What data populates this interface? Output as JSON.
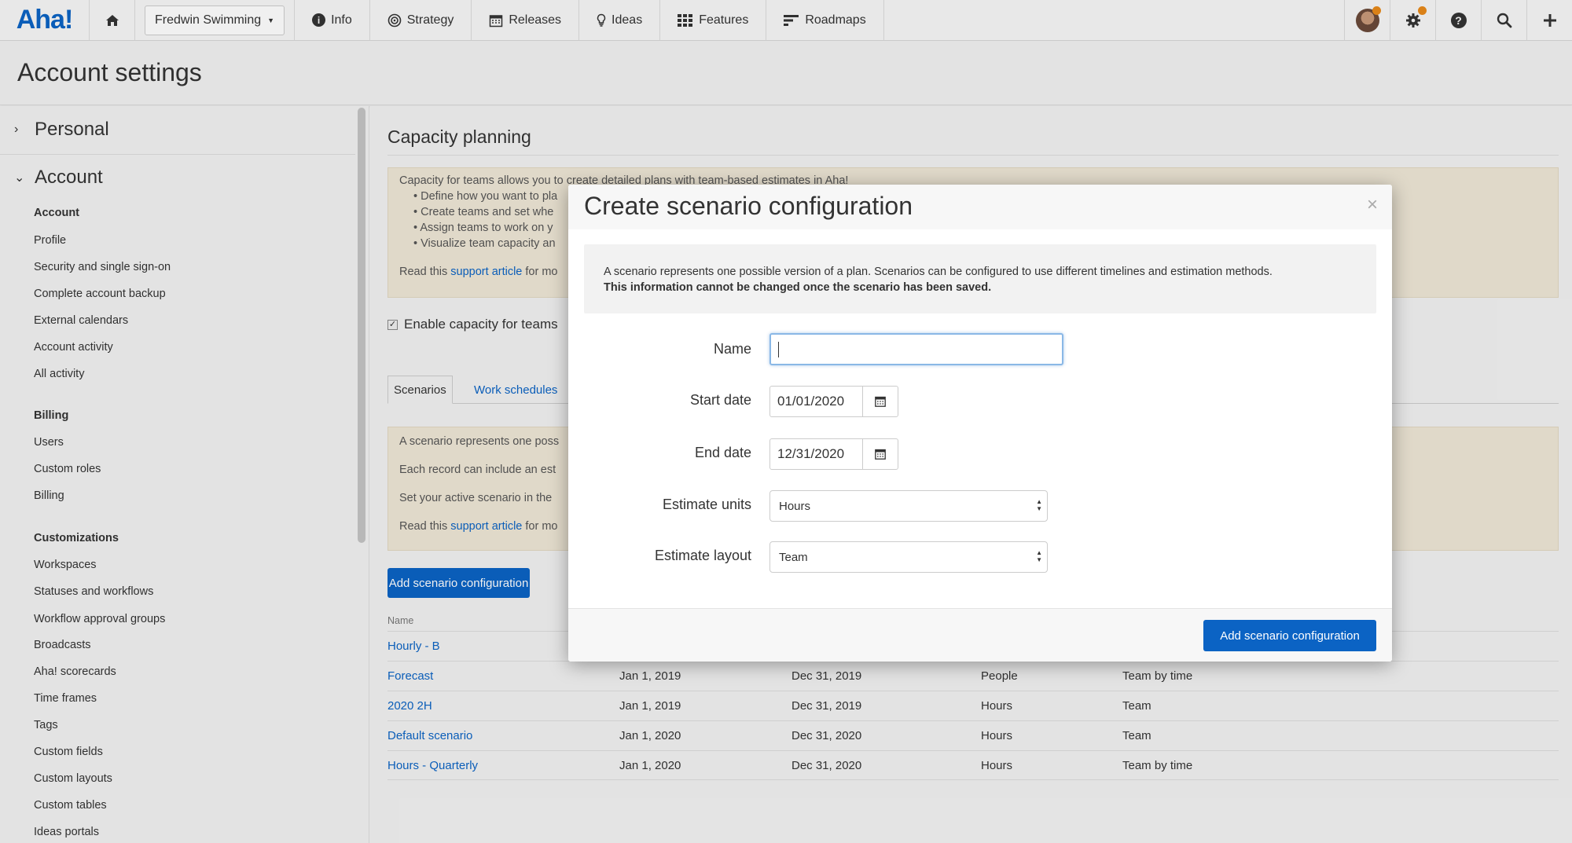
{
  "topnav": {
    "logo": "Aha!",
    "workspace": "Fredwin Swimming",
    "items": [
      {
        "label": "Info",
        "icon": "info-icon"
      },
      {
        "label": "Strategy",
        "icon": "target-icon"
      },
      {
        "label": "Releases",
        "icon": "calendar-icon"
      },
      {
        "label": "Ideas",
        "icon": "lightbulb-icon"
      },
      {
        "label": "Features",
        "icon": "grid-icon"
      },
      {
        "label": "Roadmaps",
        "icon": "roadmap-icon"
      }
    ],
    "right_icons": [
      "avatar",
      "gear-icon",
      "help-icon",
      "search-icon",
      "plus-icon"
    ],
    "notification_color": "#e88a1a"
  },
  "header": {
    "title": "Account settings"
  },
  "sidebar": {
    "personal": "Personal",
    "account": "Account",
    "groups": [
      {
        "title": "Account",
        "items": [
          "Profile",
          "Security and single sign-on",
          "Complete account backup",
          "External calendars",
          "Account activity",
          "All activity"
        ]
      },
      {
        "title": "Billing",
        "items": [
          "Users",
          "Custom roles",
          "Billing"
        ]
      },
      {
        "title": "Customizations",
        "items": [
          "Workspaces",
          "Statuses and workflows",
          "Workflow approval groups",
          "Broadcasts",
          "Aha! scorecards",
          "Time frames",
          "Tags",
          "Custom fields",
          "Custom layouts",
          "Custom tables",
          "Ideas portals"
        ]
      }
    ]
  },
  "main": {
    "title": "Capacity planning",
    "intro": {
      "line": "Capacity for teams allows you to create detailed plans with team-based estimates in Aha!",
      "bullets": [
        "Define how you want to pla",
        "Create teams and set whe",
        "Assign teams to work on y",
        "Visualize team capacity an"
      ],
      "read_prefix": "Read this ",
      "read_link": "support article",
      "read_suffix": " for mo"
    },
    "enable_label": "Enable capacity for teams",
    "tabs": [
      "Scenarios",
      "Work schedules"
    ],
    "scenario_info": {
      "lines": [
        "A scenario represents one poss",
        "Each record can include an est",
        "Set your active scenario in the"
      ],
      "read_prefix": "Read this ",
      "read_link": "support article",
      "read_suffix": " for mo"
    },
    "add_button": "Add scenario configuration",
    "table": {
      "header_name": "Name",
      "rows": [
        {
          "name": "Hourly - B",
          "start": "",
          "end": "",
          "units": "",
          "layout": ""
        },
        {
          "name": "Forecast",
          "start": "Jan 1, 2019",
          "end": "Dec 31, 2019",
          "units": "People",
          "layout": "Team by time"
        },
        {
          "name": "2020 2H",
          "start": "Jan 1, 2019",
          "end": "Dec 31, 2019",
          "units": "Hours",
          "layout": "Team"
        },
        {
          "name": "Default scenario",
          "start": "Jan 1, 2020",
          "end": "Dec 31, 2020",
          "units": "Hours",
          "layout": "Team"
        },
        {
          "name": "Hours - Quarterly",
          "start": "Jan 1, 2020",
          "end": "Dec 31, 2020",
          "units": "Hours",
          "layout": "Team by time"
        }
      ]
    }
  },
  "modal": {
    "title": "Create scenario configuration",
    "close": "×",
    "notice": "A scenario represents one possible version of a plan. Scenarios can be configured to use different timelines and estimation methods.",
    "notice_bold": "This information cannot be changed once the scenario has been saved.",
    "fields": {
      "name_label": "Name",
      "name_value": "",
      "start_label": "Start date",
      "start_value": "01/01/2020",
      "end_label": "End date",
      "end_value": "12/31/2020",
      "units_label": "Estimate units",
      "units_value": "Hours",
      "layout_label": "Estimate layout",
      "layout_value": "Team"
    },
    "submit": "Add scenario configuration"
  },
  "colors": {
    "accent": "#0b63c4",
    "info_bg": "#efe7d6"
  }
}
